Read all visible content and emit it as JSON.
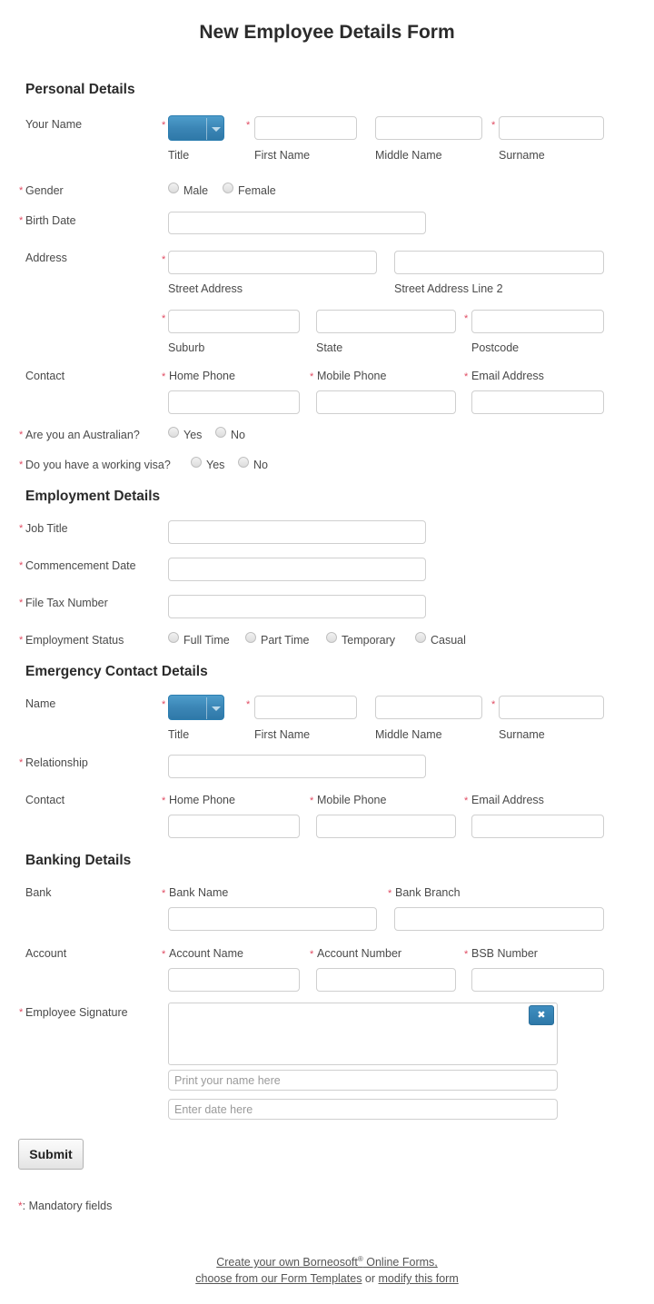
{
  "form": {
    "title": "New Employee Details Form",
    "mandatory_note": ": Mandatory fields",
    "submit_label": "Submit",
    "required_marker": "*"
  },
  "sections": {
    "personal": {
      "heading": "Personal Details",
      "name_label": "Your Name",
      "name_sub": {
        "title": "Title",
        "first": "First Name",
        "middle": "Middle Name",
        "surname": "Surname"
      },
      "gender_label": "Gender",
      "gender_options": [
        "Male",
        "Female"
      ],
      "birth_date_label": "Birth Date",
      "address_label": "Address",
      "address_sub": {
        "street": "Street Address",
        "street2": "Street Address Line 2",
        "suburb": "Suburb",
        "state": "State",
        "postcode": "Postcode"
      },
      "contact_label": "Contact",
      "contact_sub": {
        "home": "Home Phone",
        "mobile": "Mobile Phone",
        "email": "Email Address"
      },
      "australian_label": "Are you an Australian?",
      "australian_options": [
        "Yes",
        "No"
      ],
      "visa_label": "Do you have a working visa?",
      "visa_options": [
        "Yes",
        "No"
      ]
    },
    "employment": {
      "heading": "Employment Details",
      "job_title_label": "Job Title",
      "commencement_label": "Commencement Date",
      "tax_label": "File Tax Number",
      "status_label": "Employment Status",
      "status_options": [
        "Full Time",
        "Part Time",
        "Temporary",
        "Casual"
      ]
    },
    "emergency": {
      "heading": "Emergency Contact Details",
      "name_label": "Name",
      "name_sub": {
        "title": "Title",
        "first": "First Name",
        "middle": "Middle Name",
        "surname": "Surname"
      },
      "relationship_label": "Relationship",
      "contact_label": "Contact",
      "contact_sub": {
        "home": "Home Phone",
        "mobile": "Mobile Phone",
        "email": "Email Address"
      }
    },
    "banking": {
      "heading": "Banking Details",
      "bank_label": "Bank",
      "bank_sub": {
        "name": "Bank Name",
        "branch": "Bank Branch"
      },
      "account_label": "Account",
      "account_sub": {
        "name": "Account Name",
        "number": "Account Number",
        "bsb": "BSB Number"
      }
    },
    "signature": {
      "label": "Employee Signature",
      "clear_glyph": "✖",
      "print_name_placeholder": "Print your name here",
      "date_placeholder": "Enter date here"
    }
  },
  "footer": {
    "line1_a": "Create your own Borneosoft",
    "line1_sup": "®",
    "line1_b": " Online Forms,",
    "line2_a": "choose from our Form Templates",
    "line2_mid": " or ",
    "line2_b": "modify this form"
  },
  "colors": {
    "required": "#e04a62",
    "select_blue": "#3b86b6",
    "text": "#4a4a4a"
  }
}
